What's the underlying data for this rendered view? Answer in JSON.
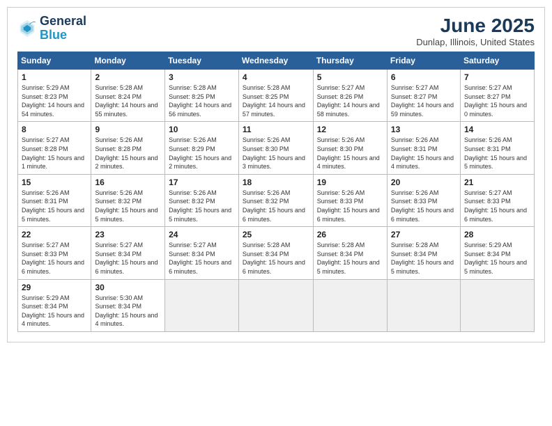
{
  "header": {
    "logo_general": "General",
    "logo_blue": "Blue",
    "month_title": "June 2025",
    "location": "Dunlap, Illinois, United States"
  },
  "weekdays": [
    "Sunday",
    "Monday",
    "Tuesday",
    "Wednesday",
    "Thursday",
    "Friday",
    "Saturday"
  ],
  "weeks": [
    [
      {
        "day": "1",
        "sunrise": "Sunrise: 5:29 AM",
        "sunset": "Sunset: 8:23 PM",
        "daylight": "Daylight: 14 hours and 54 minutes."
      },
      {
        "day": "2",
        "sunrise": "Sunrise: 5:28 AM",
        "sunset": "Sunset: 8:24 PM",
        "daylight": "Daylight: 14 hours and 55 minutes."
      },
      {
        "day": "3",
        "sunrise": "Sunrise: 5:28 AM",
        "sunset": "Sunset: 8:25 PM",
        "daylight": "Daylight: 14 hours and 56 minutes."
      },
      {
        "day": "4",
        "sunrise": "Sunrise: 5:28 AM",
        "sunset": "Sunset: 8:25 PM",
        "daylight": "Daylight: 14 hours and 57 minutes."
      },
      {
        "day": "5",
        "sunrise": "Sunrise: 5:27 AM",
        "sunset": "Sunset: 8:26 PM",
        "daylight": "Daylight: 14 hours and 58 minutes."
      },
      {
        "day": "6",
        "sunrise": "Sunrise: 5:27 AM",
        "sunset": "Sunset: 8:27 PM",
        "daylight": "Daylight: 14 hours and 59 minutes."
      },
      {
        "day": "7",
        "sunrise": "Sunrise: 5:27 AM",
        "sunset": "Sunset: 8:27 PM",
        "daylight": "Daylight: 15 hours and 0 minutes."
      }
    ],
    [
      {
        "day": "8",
        "sunrise": "Sunrise: 5:27 AM",
        "sunset": "Sunset: 8:28 PM",
        "daylight": "Daylight: 15 hours and 1 minute."
      },
      {
        "day": "9",
        "sunrise": "Sunrise: 5:26 AM",
        "sunset": "Sunset: 8:28 PM",
        "daylight": "Daylight: 15 hours and 2 minutes."
      },
      {
        "day": "10",
        "sunrise": "Sunrise: 5:26 AM",
        "sunset": "Sunset: 8:29 PM",
        "daylight": "Daylight: 15 hours and 2 minutes."
      },
      {
        "day": "11",
        "sunrise": "Sunrise: 5:26 AM",
        "sunset": "Sunset: 8:30 PM",
        "daylight": "Daylight: 15 hours and 3 minutes."
      },
      {
        "day": "12",
        "sunrise": "Sunrise: 5:26 AM",
        "sunset": "Sunset: 8:30 PM",
        "daylight": "Daylight: 15 hours and 4 minutes."
      },
      {
        "day": "13",
        "sunrise": "Sunrise: 5:26 AM",
        "sunset": "Sunset: 8:31 PM",
        "daylight": "Daylight: 15 hours and 4 minutes."
      },
      {
        "day": "14",
        "sunrise": "Sunrise: 5:26 AM",
        "sunset": "Sunset: 8:31 PM",
        "daylight": "Daylight: 15 hours and 5 minutes."
      }
    ],
    [
      {
        "day": "15",
        "sunrise": "Sunrise: 5:26 AM",
        "sunset": "Sunset: 8:31 PM",
        "daylight": "Daylight: 15 hours and 5 minutes."
      },
      {
        "day": "16",
        "sunrise": "Sunrise: 5:26 AM",
        "sunset": "Sunset: 8:32 PM",
        "daylight": "Daylight: 15 hours and 5 minutes."
      },
      {
        "day": "17",
        "sunrise": "Sunrise: 5:26 AM",
        "sunset": "Sunset: 8:32 PM",
        "daylight": "Daylight: 15 hours and 5 minutes."
      },
      {
        "day": "18",
        "sunrise": "Sunrise: 5:26 AM",
        "sunset": "Sunset: 8:32 PM",
        "daylight": "Daylight: 15 hours and 6 minutes."
      },
      {
        "day": "19",
        "sunrise": "Sunrise: 5:26 AM",
        "sunset": "Sunset: 8:33 PM",
        "daylight": "Daylight: 15 hours and 6 minutes."
      },
      {
        "day": "20",
        "sunrise": "Sunrise: 5:26 AM",
        "sunset": "Sunset: 8:33 PM",
        "daylight": "Daylight: 15 hours and 6 minutes."
      },
      {
        "day": "21",
        "sunrise": "Sunrise: 5:27 AM",
        "sunset": "Sunset: 8:33 PM",
        "daylight": "Daylight: 15 hours and 6 minutes."
      }
    ],
    [
      {
        "day": "22",
        "sunrise": "Sunrise: 5:27 AM",
        "sunset": "Sunset: 8:33 PM",
        "daylight": "Daylight: 15 hours and 6 minutes."
      },
      {
        "day": "23",
        "sunrise": "Sunrise: 5:27 AM",
        "sunset": "Sunset: 8:34 PM",
        "daylight": "Daylight: 15 hours and 6 minutes."
      },
      {
        "day": "24",
        "sunrise": "Sunrise: 5:27 AM",
        "sunset": "Sunset: 8:34 PM",
        "daylight": "Daylight: 15 hours and 6 minutes."
      },
      {
        "day": "25",
        "sunrise": "Sunrise: 5:28 AM",
        "sunset": "Sunset: 8:34 PM",
        "daylight": "Daylight: 15 hours and 6 minutes."
      },
      {
        "day": "26",
        "sunrise": "Sunrise: 5:28 AM",
        "sunset": "Sunset: 8:34 PM",
        "daylight": "Daylight: 15 hours and 5 minutes."
      },
      {
        "day": "27",
        "sunrise": "Sunrise: 5:28 AM",
        "sunset": "Sunset: 8:34 PM",
        "daylight": "Daylight: 15 hours and 5 minutes."
      },
      {
        "day": "28",
        "sunrise": "Sunrise: 5:29 AM",
        "sunset": "Sunset: 8:34 PM",
        "daylight": "Daylight: 15 hours and 5 minutes."
      }
    ],
    [
      {
        "day": "29",
        "sunrise": "Sunrise: 5:29 AM",
        "sunset": "Sunset: 8:34 PM",
        "daylight": "Daylight: 15 hours and 4 minutes."
      },
      {
        "day": "30",
        "sunrise": "Sunrise: 5:30 AM",
        "sunset": "Sunset: 8:34 PM",
        "daylight": "Daylight: 15 hours and 4 minutes."
      },
      null,
      null,
      null,
      null,
      null
    ]
  ]
}
